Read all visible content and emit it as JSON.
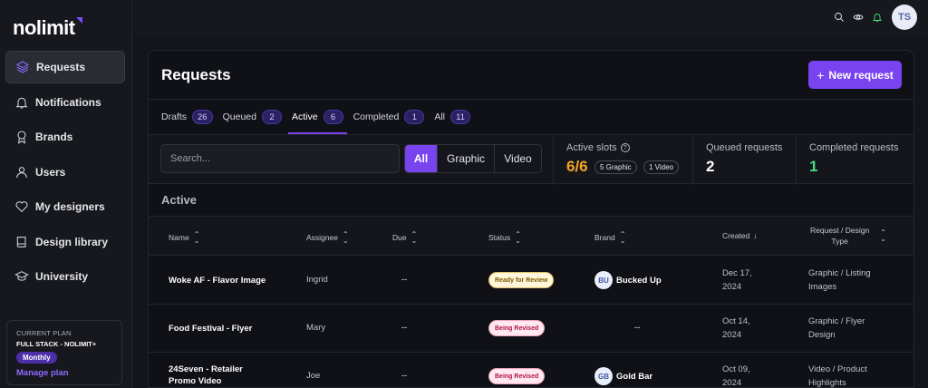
{
  "sidebar": {
    "logo": "nolimit",
    "items": [
      {
        "label": "Requests",
        "icon": "layers-icon",
        "active": true
      },
      {
        "label": "Notifications",
        "icon": "bell-icon"
      },
      {
        "label": "Brands",
        "icon": "award-icon"
      },
      {
        "label": "Users",
        "icon": "user-icon"
      },
      {
        "label": "My designers",
        "icon": "heart-icon"
      },
      {
        "label": "Design library",
        "icon": "book-icon"
      },
      {
        "label": "University",
        "icon": "graduation-cap-icon"
      }
    ],
    "plan": {
      "caption": "CURRENT PLAN",
      "name": "FULL STACK - NOLIMIT+",
      "badge": "Monthly",
      "manage": "Manage plan"
    }
  },
  "topbar": {
    "avatar_initials": "TS"
  },
  "page": {
    "title": "Requests",
    "new_button": "New request"
  },
  "tabs": [
    {
      "label": "Drafts",
      "count": "26"
    },
    {
      "label": "Queued",
      "count": "2"
    },
    {
      "label": "Active",
      "count": "6",
      "active": true
    },
    {
      "label": "Completed",
      "count": "1"
    },
    {
      "label": "All",
      "count": "11"
    }
  ],
  "filters": {
    "search_placeholder": "Search...",
    "segments": [
      "All",
      "Graphic",
      "Video"
    ],
    "selected": "All"
  },
  "stats": {
    "active_slots_label": "Active slots",
    "active_slots_value": "6/6",
    "graphic_pill": "5 Graphic",
    "video_pill": "1 Video",
    "queued_label": "Queued requests",
    "queued_value": "2",
    "completed_label": "Completed requests",
    "completed_value": "1"
  },
  "section": {
    "title": "Active"
  },
  "table": {
    "headers": {
      "name": "Name",
      "assignee": "Assignee",
      "due": "Due",
      "status": "Status",
      "brand": "Brand",
      "created": "Created",
      "type_line1": "Request / Design",
      "type_line2": "Type"
    },
    "rows": [
      {
        "name_line1": "Woke AF - Flavor Image",
        "name_line2": "",
        "assignee": "Ingrid",
        "due": "--",
        "status": "Ready for Review",
        "status_kind": "ready",
        "brand_initials": "BU",
        "brand": "Bucked Up",
        "created_line1": "Dec 17,",
        "created_line2": "2024",
        "type_line1": "Graphic / Listing",
        "type_line2": "Images"
      },
      {
        "name_line1": "Food Festival - Flyer",
        "name_line2": "",
        "assignee": "Mary",
        "due": "--",
        "status": "Being Revised",
        "status_kind": "revised",
        "brand_initials": "",
        "brand": "--",
        "created_line1": "Oct 14,",
        "created_line2": "2024",
        "type_line1": "Graphic / Flyer",
        "type_line2": "Design"
      },
      {
        "name_line1": "24Seven - Retailer",
        "name_line2": "Promo Video",
        "assignee": "Joe",
        "due": "--",
        "status": "Being Revised",
        "status_kind": "revised",
        "brand_initials": "GB",
        "brand": "Gold Bar",
        "created_line1": "Oct 09,",
        "created_line2": "2024",
        "type_line1": "Video / Product",
        "type_line2": "Highlights"
      }
    ]
  },
  "colors": {
    "accent": "#7a43f0",
    "slots_value": "#f5a524",
    "completed_value": "#4ade80"
  }
}
